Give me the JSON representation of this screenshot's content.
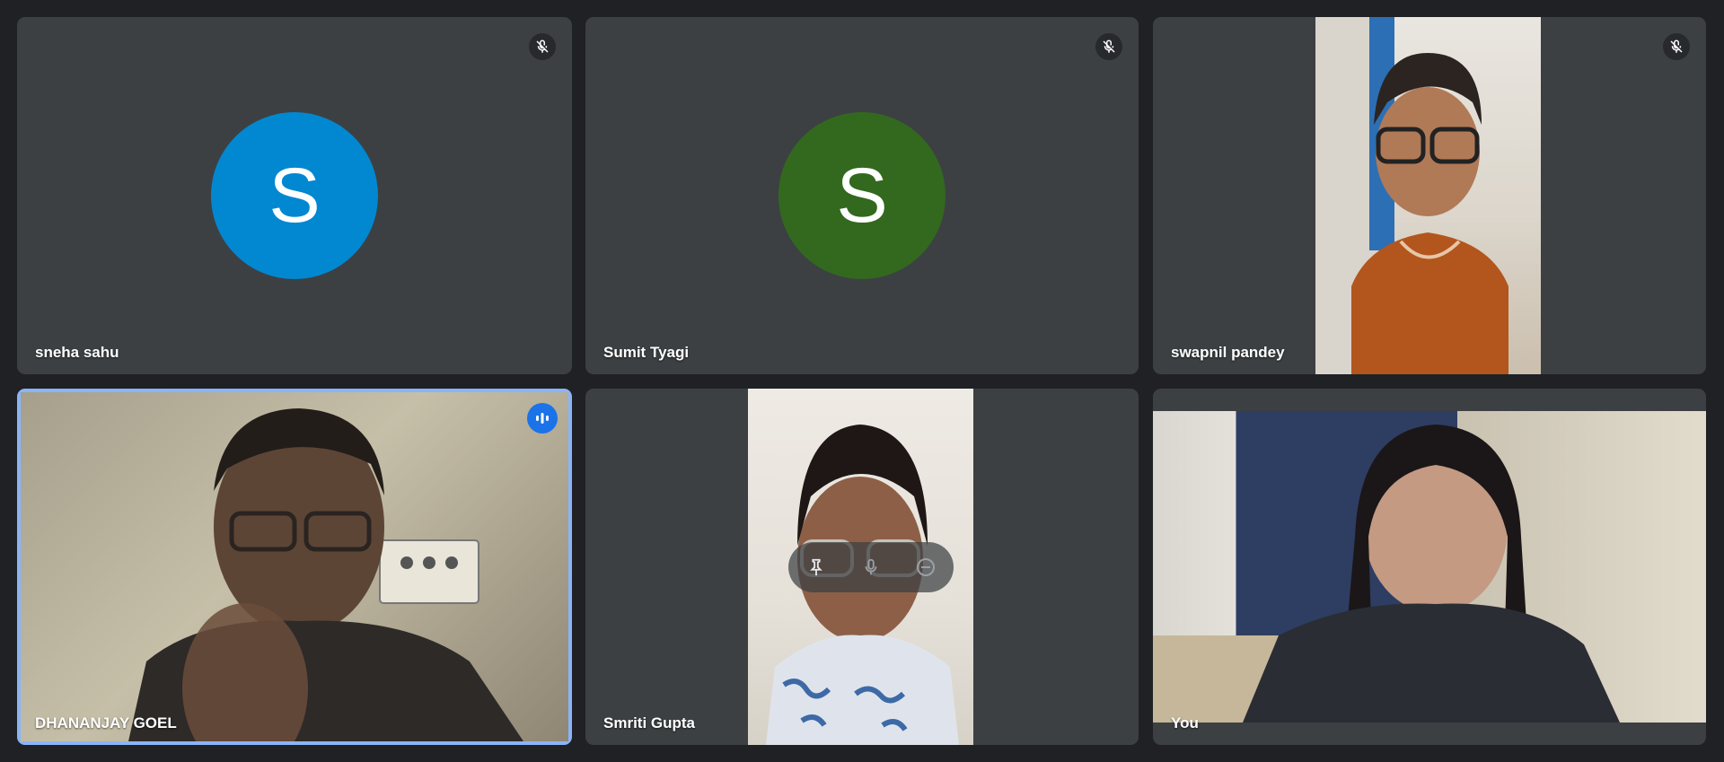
{
  "participants": [
    {
      "name": "sneha sahu",
      "initial": "S",
      "avatar_color": "#0288d1",
      "muted": true
    },
    {
      "name": "Sumit Tyagi",
      "initial": "S",
      "avatar_color": "#33691e",
      "muted": true
    },
    {
      "name": "swapnil pandey",
      "muted": true
    },
    {
      "name": "DHANANJAY GOEL",
      "speaking": true
    },
    {
      "name": "Smriti Gupta"
    },
    {
      "name": "You"
    }
  ],
  "icons": {
    "mute": "mic-off-icon",
    "speaking": "audio-level-icon",
    "pin": "pin-icon",
    "mic": "mic-icon",
    "remove": "remove-icon"
  },
  "colors": {
    "tile_bg": "#3c4043",
    "page_bg": "#202124",
    "active_speaker_border": "#8ab4f8"
  }
}
